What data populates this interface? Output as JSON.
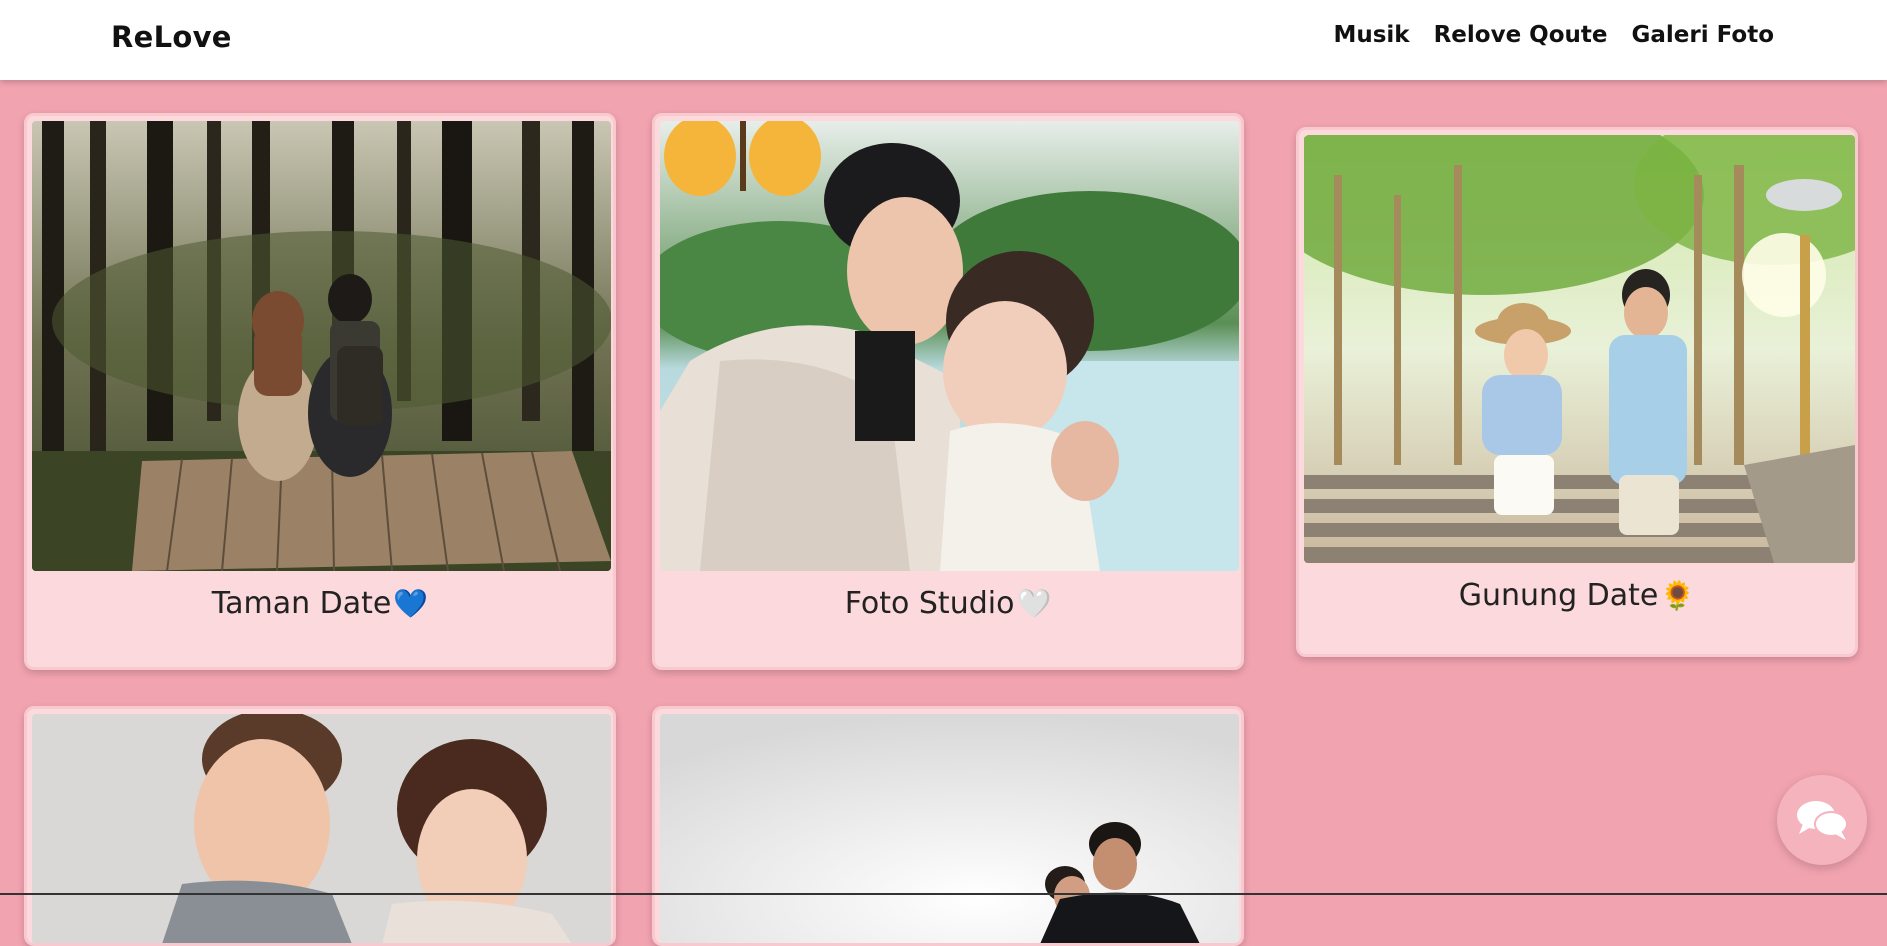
{
  "navbar": {
    "brand": "ReLove",
    "links": [
      {
        "label": "Musik"
      },
      {
        "label": "Relove Qoute"
      },
      {
        "label": "Galeri Foto"
      }
    ]
  },
  "gallery": {
    "cards": [
      {
        "caption": "Taman Date",
        "emoji": "💙"
      },
      {
        "caption": "Foto Studio",
        "emoji": "🤍"
      },
      {
        "caption": "Gunung Date",
        "emoji": "🌻"
      },
      {
        "caption": ""
      },
      {
        "caption": ""
      }
    ]
  },
  "chat": {
    "icon": "chat-bubbles-icon"
  }
}
